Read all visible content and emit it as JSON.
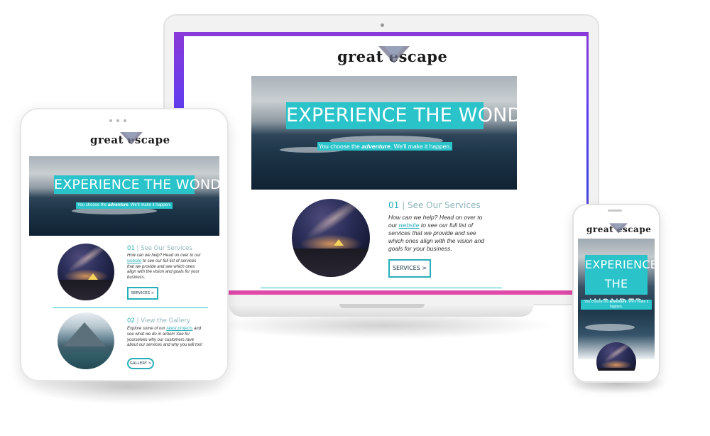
{
  "site": {
    "brand": "great escape",
    "hero": {
      "title": "EXPERIENCE THE WONDER",
      "subtitle_pre": "You choose the ",
      "subtitle_em": "adventure",
      "subtitle_post": ". We'll make it happen.",
      "phone_subtitle_post": ". We'll make it happen."
    },
    "section1": {
      "number": "01",
      "separator": "|",
      "title": "See Our Services",
      "text_pre": "How can we help? Head on over to our ",
      "link": "website",
      "text_post": " to see our full list of services that we provide and see which ones align with the vision and goals for your business.",
      "button": "SERVICES >"
    },
    "section2": {
      "number": "02",
      "separator": "|",
      "title": "View the Gallery",
      "text_pre": "Explore some of our ",
      "link": "latest projects",
      "text_post": " and see what we do in action! See for yourselves why our customers rave about our services and why you will too!",
      "button": "GALLERY >"
    }
  },
  "colors": {
    "accent": "#29c3c9",
    "accent_dark": "#29aeb9",
    "gradient": [
      "#8a3ad8",
      "#3f46e0",
      "#e24aa8"
    ]
  },
  "icons": [
    "triangle-logo-icon",
    "camera-icon",
    "speaker-icon"
  ]
}
